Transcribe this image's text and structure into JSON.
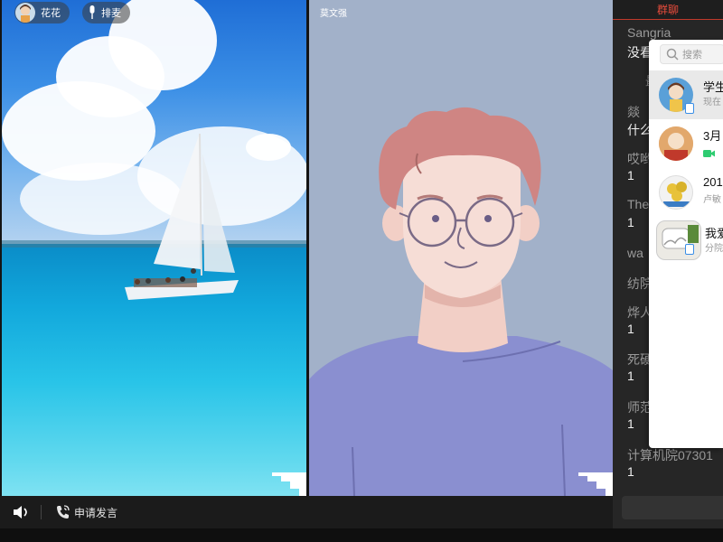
{
  "left_tile": {
    "user_pill": {
      "name": "花花"
    },
    "mic_pill": {
      "label": "排麦"
    }
  },
  "right_tile": {
    "name": "莫文强"
  },
  "bottom_bar": {
    "apply_label": "申请发言"
  },
  "chat_panel": {
    "tab": "群聊",
    "messages": [
      {
        "name": "Sangria",
        "text": "没看"
      },
      {
        "name": "",
        "text": ""
      },
      {
        "name": "燚",
        "text": "什么"
      },
      {
        "name": "哎哟",
        "text": "1"
      },
      {
        "name": "The",
        "text": "1"
      },
      {
        "name": "wa",
        "text": ""
      },
      {
        "name": "纺院",
        "text": ""
      },
      {
        "name": "烨人",
        "text": "1"
      },
      {
        "name": "死硬",
        "text": "1"
      },
      {
        "name": "师范",
        "text": "1"
      },
      {
        "name": "计算机院07301",
        "text": "1"
      }
    ],
    "partial_mid": "最"
  },
  "popup": {
    "search_placeholder": "搜索",
    "conversations": [
      {
        "title": "学生",
        "sub": "现在"
      },
      {
        "title": "3月",
        "sub": ""
      },
      {
        "title": "201",
        "sub": "卢敏"
      },
      {
        "title": "我爱",
        "sub": "分院"
      }
    ]
  },
  "colors": {
    "accent_red": "#e74c3c",
    "panel_bg": "#262626",
    "right_tile_bg": "#a2b1c9",
    "shirt": "#8a8fd0",
    "hair": "#cf8583"
  }
}
